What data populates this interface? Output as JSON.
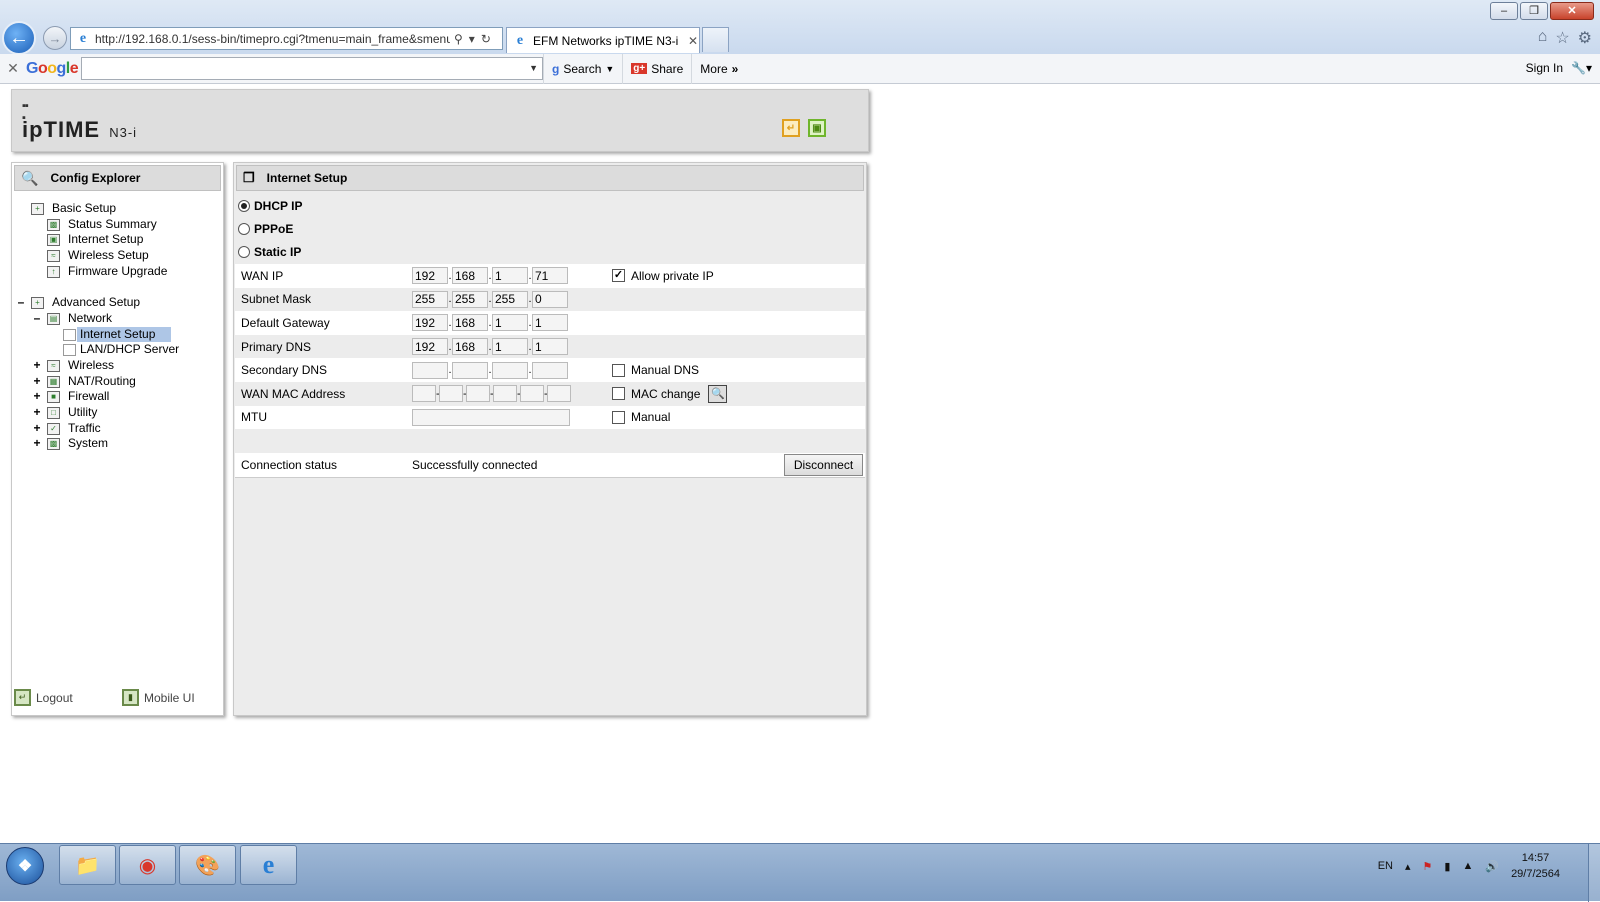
{
  "browser": {
    "address": "http://192.168.0.1/sess-bin/timepro.cgi?tmenu=main_frame&smenu",
    "tab_title": "EFM Networks ipTIME N3-i",
    "toolbar": {
      "google": "Google",
      "search": "Search",
      "share": "Share",
      "more": "More",
      "sign_in": "Sign In"
    }
  },
  "brand": {
    "name": "ipTIME",
    "model": "N3-i"
  },
  "config_explorer": {
    "title": "Config Explorer",
    "basic_setup": {
      "label": "Basic Setup",
      "items": [
        "Status Summary",
        "Internet Setup",
        "Wireless Setup",
        "Firmware Upgrade"
      ]
    },
    "advanced_setup": {
      "label": "Advanced Setup",
      "network": {
        "label": "Network",
        "items": [
          "Internet Setup",
          "LAN/DHCP Server"
        ]
      },
      "items": [
        "Wireless",
        "NAT/Routing",
        "Firewall",
        "Utility",
        "Traffic",
        "System"
      ]
    },
    "footer": {
      "logout": "Logout",
      "mobile_ui": "Mobile UI"
    }
  },
  "internet_setup": {
    "title": "Internet Setup",
    "modes": [
      "DHCP IP",
      "PPPoE",
      "Static IP"
    ],
    "selected_mode": "DHCP IP",
    "fields": {
      "wan_ip": {
        "label": "WAN IP",
        "octets": [
          "192",
          "168",
          "1",
          "71"
        ],
        "option": "Allow private IP",
        "option_checked": true
      },
      "subnet_mask": {
        "label": "Subnet Mask",
        "octets": [
          "255",
          "255",
          "255",
          "0"
        ]
      },
      "default_gateway": {
        "label": "Default Gateway",
        "octets": [
          "192",
          "168",
          "1",
          "1"
        ]
      },
      "primary_dns": {
        "label": "Primary DNS",
        "octets": [
          "192",
          "168",
          "1",
          "1"
        ]
      },
      "secondary_dns": {
        "label": "Secondary DNS",
        "octets": [
          "",
          "",
          "",
          ""
        ],
        "option": "Manual DNS",
        "option_checked": false
      },
      "wan_mac": {
        "label": "WAN MAC Address",
        "option": "MAC change",
        "option_checked": false
      },
      "mtu": {
        "label": "MTU",
        "option": "Manual",
        "option_checked": false
      }
    },
    "connection": {
      "label": "Connection status",
      "value": "Successfully connected",
      "button": "Disconnect"
    }
  },
  "taskbar": {
    "lang": "EN",
    "time": "14:57",
    "date": "29/7/2564"
  }
}
